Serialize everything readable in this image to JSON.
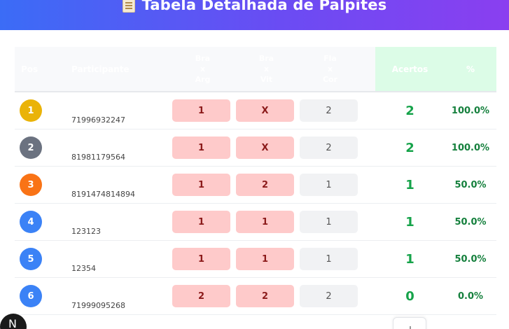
{
  "header": {
    "title": "Tabela Detalhada de Palpites",
    "icon": "document-icon"
  },
  "table": {
    "columns": {
      "pos": "Pos",
      "participant": "Participante",
      "games": [
        {
          "home": "Bra",
          "sep": "x",
          "away": "Arg"
        },
        {
          "home": "Bra",
          "sep": "x",
          "away": "Vit"
        },
        {
          "home": "Fla",
          "sep": "x",
          "away": "Cor"
        }
      ],
      "acertos": "Acertos",
      "pct": "%"
    },
    "rows": [
      {
        "pos": "1",
        "participant": "71996932247",
        "picks": [
          "1",
          "X",
          "2"
        ],
        "acertos": "2",
        "pct": "100.0%",
        "badge_color": "#eab308"
      },
      {
        "pos": "2",
        "participant": "81981179564",
        "picks": [
          "1",
          "X",
          "2"
        ],
        "acertos": "2",
        "pct": "100.0%",
        "badge_color": "#6b7280"
      },
      {
        "pos": "3",
        "participant": "8191474814894",
        "picks": [
          "1",
          "2",
          "1"
        ],
        "acertos": "1",
        "pct": "50.0%",
        "badge_color": "#f97316"
      },
      {
        "pos": "4",
        "participant": "123123",
        "picks": [
          "1",
          "1",
          "1"
        ],
        "acertos": "1",
        "pct": "50.0%",
        "badge_color": "#3b82f6"
      },
      {
        "pos": "5",
        "participant": "12354",
        "picks": [
          "1",
          "1",
          "1"
        ],
        "acertos": "1",
        "pct": "50.0%",
        "badge_color": "#3b82f6"
      },
      {
        "pos": "6",
        "participant": "71999095268",
        "picks": [
          "2",
          "2",
          "2"
        ],
        "acertos": "0",
        "pct": "0.0%",
        "badge_color": "#3b82f6"
      }
    ]
  },
  "overlay": {
    "next_logo": "N"
  },
  "colors": {
    "header_gradient": [
      "#3b6cf6",
      "#8a3ff0"
    ],
    "pick_highlight": "#fecaca",
    "pick_neutral": "#f1f2f4",
    "acertos_text": "#16a34a",
    "acertos_header_bg": "#dcfce7"
  }
}
